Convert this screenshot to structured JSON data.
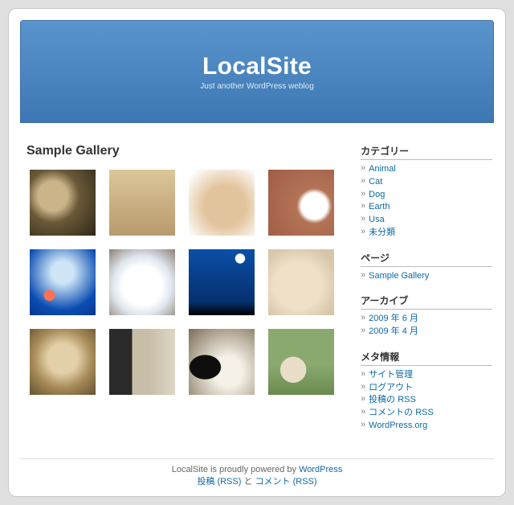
{
  "header": {
    "site_title": "LocalSite",
    "tagline": "Just another WordPress weblog"
  },
  "content": {
    "post_title": "Sample Gallery",
    "thumbs": [
      {
        "name": "thumb-cat",
        "cls": "th-cat1"
      },
      {
        "name": "thumb-rabbit",
        "cls": "th-rabbit1"
      },
      {
        "name": "thumb-rabbit-white",
        "cls": "th-rabbit2"
      },
      {
        "name": "thumb-kitten",
        "cls": "th-kitten"
      },
      {
        "name": "thumb-fish",
        "cls": "th-fish"
      },
      {
        "name": "thumb-polar-bear",
        "cls": "th-polar"
      },
      {
        "name": "thumb-sea",
        "cls": "th-sea"
      },
      {
        "name": "thumb-rabbit-sleep",
        "cls": "th-rabbitsleep"
      },
      {
        "name": "thumb-cat-closeup",
        "cls": "th-cat2"
      },
      {
        "name": "thumb-dog-sniff",
        "cls": "th-dog1"
      },
      {
        "name": "thumb-dog-sit",
        "cls": "th-dog2"
      },
      {
        "name": "thumb-puppies",
        "cls": "th-puppies"
      }
    ]
  },
  "sidebar": {
    "widgets": [
      {
        "title": "カテゴリー",
        "key": "categories",
        "items": [
          "Animal",
          "Cat",
          "Dog",
          "Earth",
          "Usa",
          "未分類"
        ]
      },
      {
        "title": "ページ",
        "key": "pages",
        "items": [
          "Sample Gallery"
        ]
      },
      {
        "title": "アーカイブ",
        "key": "archives",
        "items": [
          "2009 年 6 月",
          "2009 年 4 月"
        ]
      },
      {
        "title": "メタ情報",
        "key": "meta",
        "items": [
          "サイト管理",
          "ログアウト",
          "投稿の RSS",
          "コメントの RSS",
          "WordPress.org"
        ]
      }
    ]
  },
  "footer": {
    "line1_prefix": "LocalSite is proudly powered by ",
    "line1_link": "WordPress",
    "posts_rss": "投稿 (RSS)",
    "joiner": " と ",
    "comments_rss": "コメント (RSS)"
  }
}
